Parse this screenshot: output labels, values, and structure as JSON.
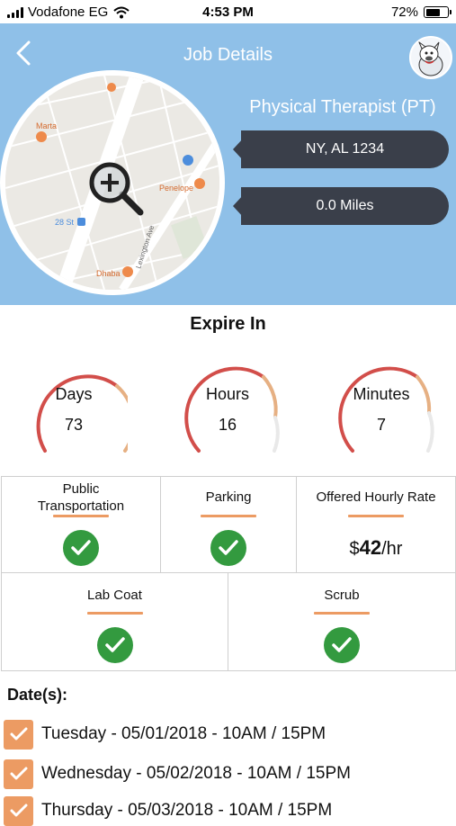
{
  "status_bar": {
    "carrier": "Vodafone EG",
    "time": "4:53 PM",
    "battery": "72%",
    "battery_level": 0.72
  },
  "header": {
    "title": "Job Details",
    "back_icon": "chevron-left-icon",
    "avatar_icon": "mascot-avatar-icon"
  },
  "map": {
    "labels": [
      "Marta",
      "Penelope",
      "28 St",
      "Dhaba",
      "Lexington Ave"
    ],
    "zoom_icon": "magnifier-plus-icon"
  },
  "job": {
    "title": "Physical Therapist (PT)",
    "location": "NY, AL 1234",
    "distance": "0.0 Miles"
  },
  "expire": {
    "title": "Expire In",
    "gauges": [
      {
        "label": "Days",
        "value": "73"
      },
      {
        "label": "Hours",
        "value": "16"
      },
      {
        "label": "Minutes",
        "value": "7"
      }
    ]
  },
  "amenities": {
    "public_transportation_line1": "Public",
    "public_transportation_line2": "Transportation",
    "parking": "Parking",
    "rate_label": "Offered Hourly Rate",
    "rate_currency": "$",
    "rate_value": "42",
    "rate_unit": "/hr",
    "lab_coat": "Lab Coat",
    "scrub": "Scrub"
  },
  "dates": {
    "title": "Date(s):",
    "items": [
      "Tuesday - 05/01/2018 - 10AM  / 15PM",
      "Wednesday - 05/02/2018 - 10AM  / 15PM",
      "Thursday - 05/03/2018 - 10AM  / 15PM"
    ]
  },
  "colors": {
    "header_bg": "#8fc0e8",
    "pill_bg": "#3a3f4a",
    "accent_orange": "#ec9b63",
    "check_green": "#339a3f",
    "gauge_red": "#d9534f"
  }
}
